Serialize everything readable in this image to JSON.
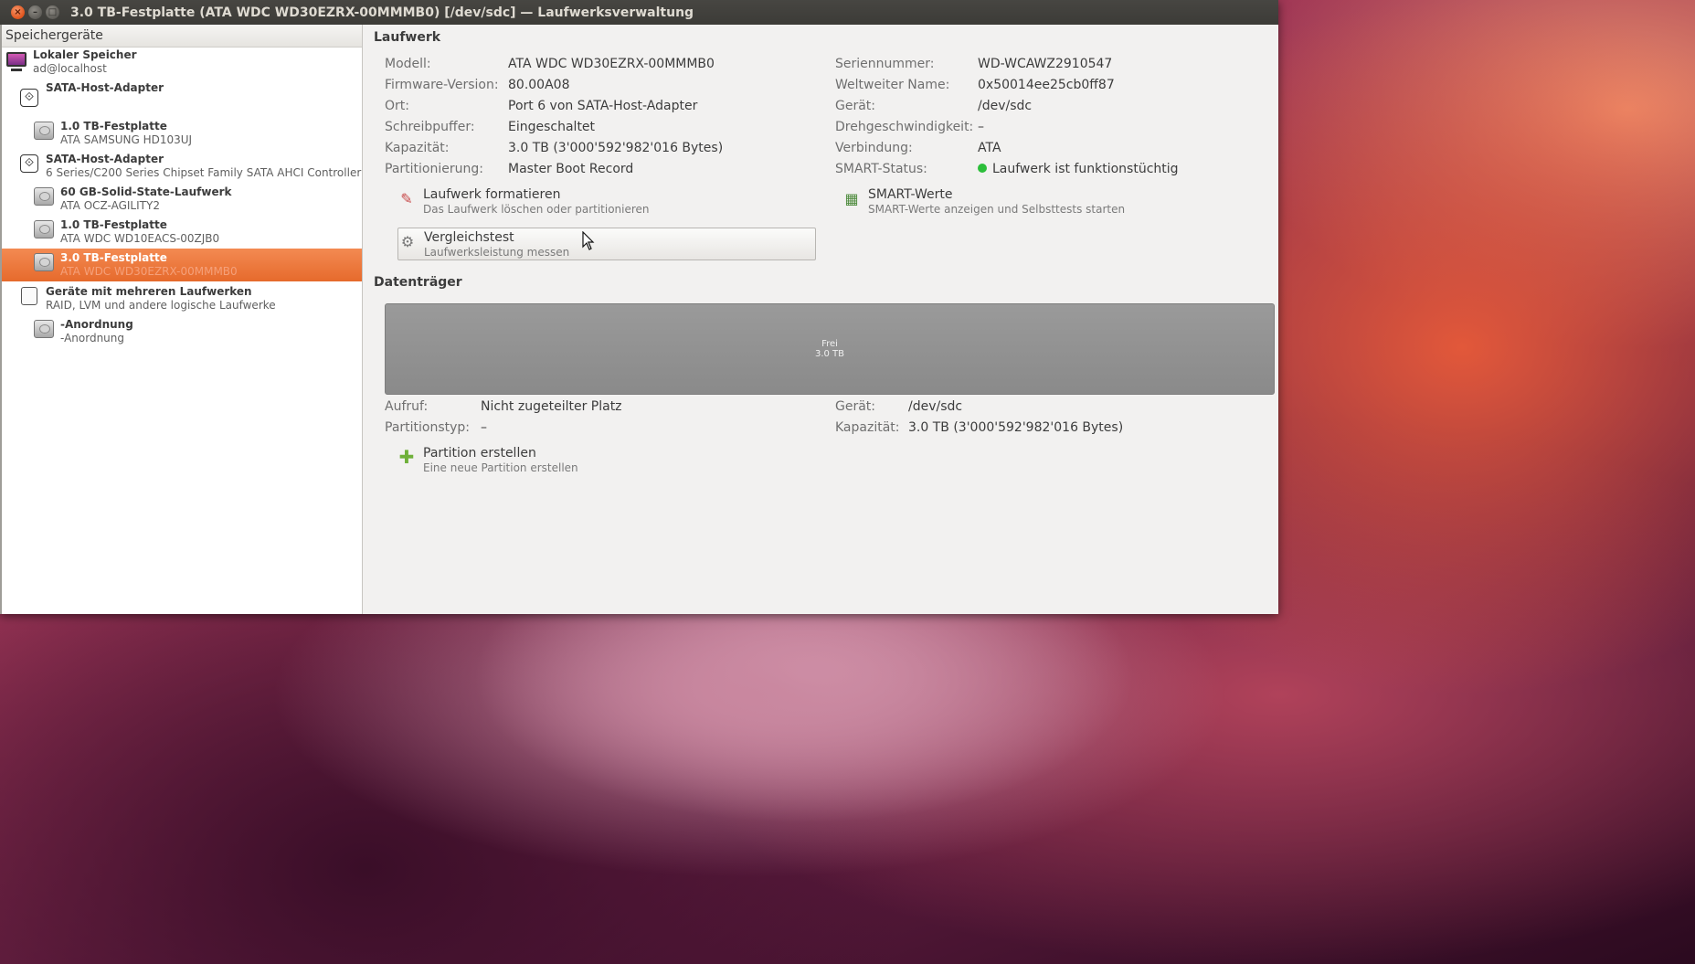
{
  "window": {
    "title": "3.0 TB-Festplatte (ATA WDC WD30EZRX-00MMMB0) [/dev/sdc] — Laufwerksverwaltung",
    "close_glyph": "×",
    "min_glyph": "–",
    "max_glyph": "□"
  },
  "sidebar": {
    "header": "Speichergeräte",
    "items": [
      {
        "title": "Lokaler Speicher",
        "subtitle": "ad@localhost",
        "icon": "computer-icon"
      },
      {
        "title": "SATA-Host-Adapter",
        "subtitle": "",
        "icon": "adapter-icon"
      },
      {
        "title": "1.0 TB-Festplatte",
        "subtitle": "ATA SAMSUNG HD103UJ",
        "icon": "harddisk-icon"
      },
      {
        "title": "SATA-Host-Adapter",
        "subtitle": "6 Series/C200 Series Chipset Family SATA AHCI Controller",
        "icon": "adapter-icon"
      },
      {
        "title": "60 GB-Solid-State-Laufwerk",
        "subtitle": "ATA OCZ-AGILITY2",
        "icon": "harddisk-icon"
      },
      {
        "title": "1.0 TB-Festplatte",
        "subtitle": "ATA WDC WD10EACS-00ZJB0",
        "icon": "harddisk-icon"
      },
      {
        "title": "3.0 TB-Festplatte",
        "subtitle": "ATA WDC WD30EZRX-00MMMB0",
        "icon": "harddisk-icon",
        "selected": true
      },
      {
        "title": "Geräte mit mehreren Laufwerken",
        "subtitle": "RAID, LVM und andere logische Laufwerke",
        "icon": "raid-icon"
      },
      {
        "title": "-Anordnung",
        "subtitle": "-Anordnung",
        "icon": "harddisk-icon"
      }
    ]
  },
  "drive": {
    "section_title": "Laufwerk",
    "left": [
      {
        "label": "Modell:",
        "value": "ATA WDC WD30EZRX-00MMMB0"
      },
      {
        "label": "Firmware-Version:",
        "value": "80.00A08"
      },
      {
        "label": "Ort:",
        "value": "Port 6 von SATA-Host-Adapter"
      },
      {
        "label": "Schreibpuffer:",
        "value": "Eingeschaltet"
      },
      {
        "label": "Kapazität:",
        "value": "3.0 TB (3'000'592'982'016 Bytes)"
      },
      {
        "label": "Partitionierung:",
        "value": "Master Boot Record"
      }
    ],
    "right": [
      {
        "label": "Seriennummer:",
        "value": "WD-WCAWZ2910547"
      },
      {
        "label": "Weltweiter Name:",
        "value": "0x50014ee25cb0ff87"
      },
      {
        "label": "Gerät:",
        "value": "/dev/sdc"
      },
      {
        "label": "Drehgeschwindigkeit:",
        "value": "–"
      },
      {
        "label": "Verbindung:",
        "value": "ATA"
      },
      {
        "label": "SMART-Status:",
        "value": "Laufwerk ist funktionstüchtig",
        "status_color": "#2cbe3a"
      }
    ],
    "actions": {
      "format": {
        "title": "Laufwerk formatieren",
        "subtitle": "Das Laufwerk löschen oder partitionieren"
      },
      "smart": {
        "title": "SMART-Werte",
        "subtitle": "SMART-Werte anzeigen und Selbsttests starten"
      },
      "benchmark": {
        "title": "Vergleichstest",
        "subtitle": "Laufwerksleistung messen"
      }
    }
  },
  "volumes": {
    "section_title": "Datenträger",
    "bar": {
      "label": "Frei",
      "size": "3.0 TB"
    },
    "left": [
      {
        "label": "Aufruf:",
        "value": "Nicht zugeteilter Platz"
      },
      {
        "label": "Partitionstyp:",
        "value": "–"
      }
    ],
    "right": [
      {
        "label": "Gerät:",
        "value": "/dev/sdc"
      },
      {
        "label": "Kapazität:",
        "value": "3.0 TB (3'000'592'982'016 Bytes)"
      }
    ],
    "actions": {
      "create": {
        "title": "Partition erstellen",
        "subtitle": "Eine neue Partition erstellen"
      }
    }
  },
  "colors": {
    "selection": "#e66a2c",
    "titlebar": "#3c3b37",
    "window_bg": "#f2f1f0"
  }
}
